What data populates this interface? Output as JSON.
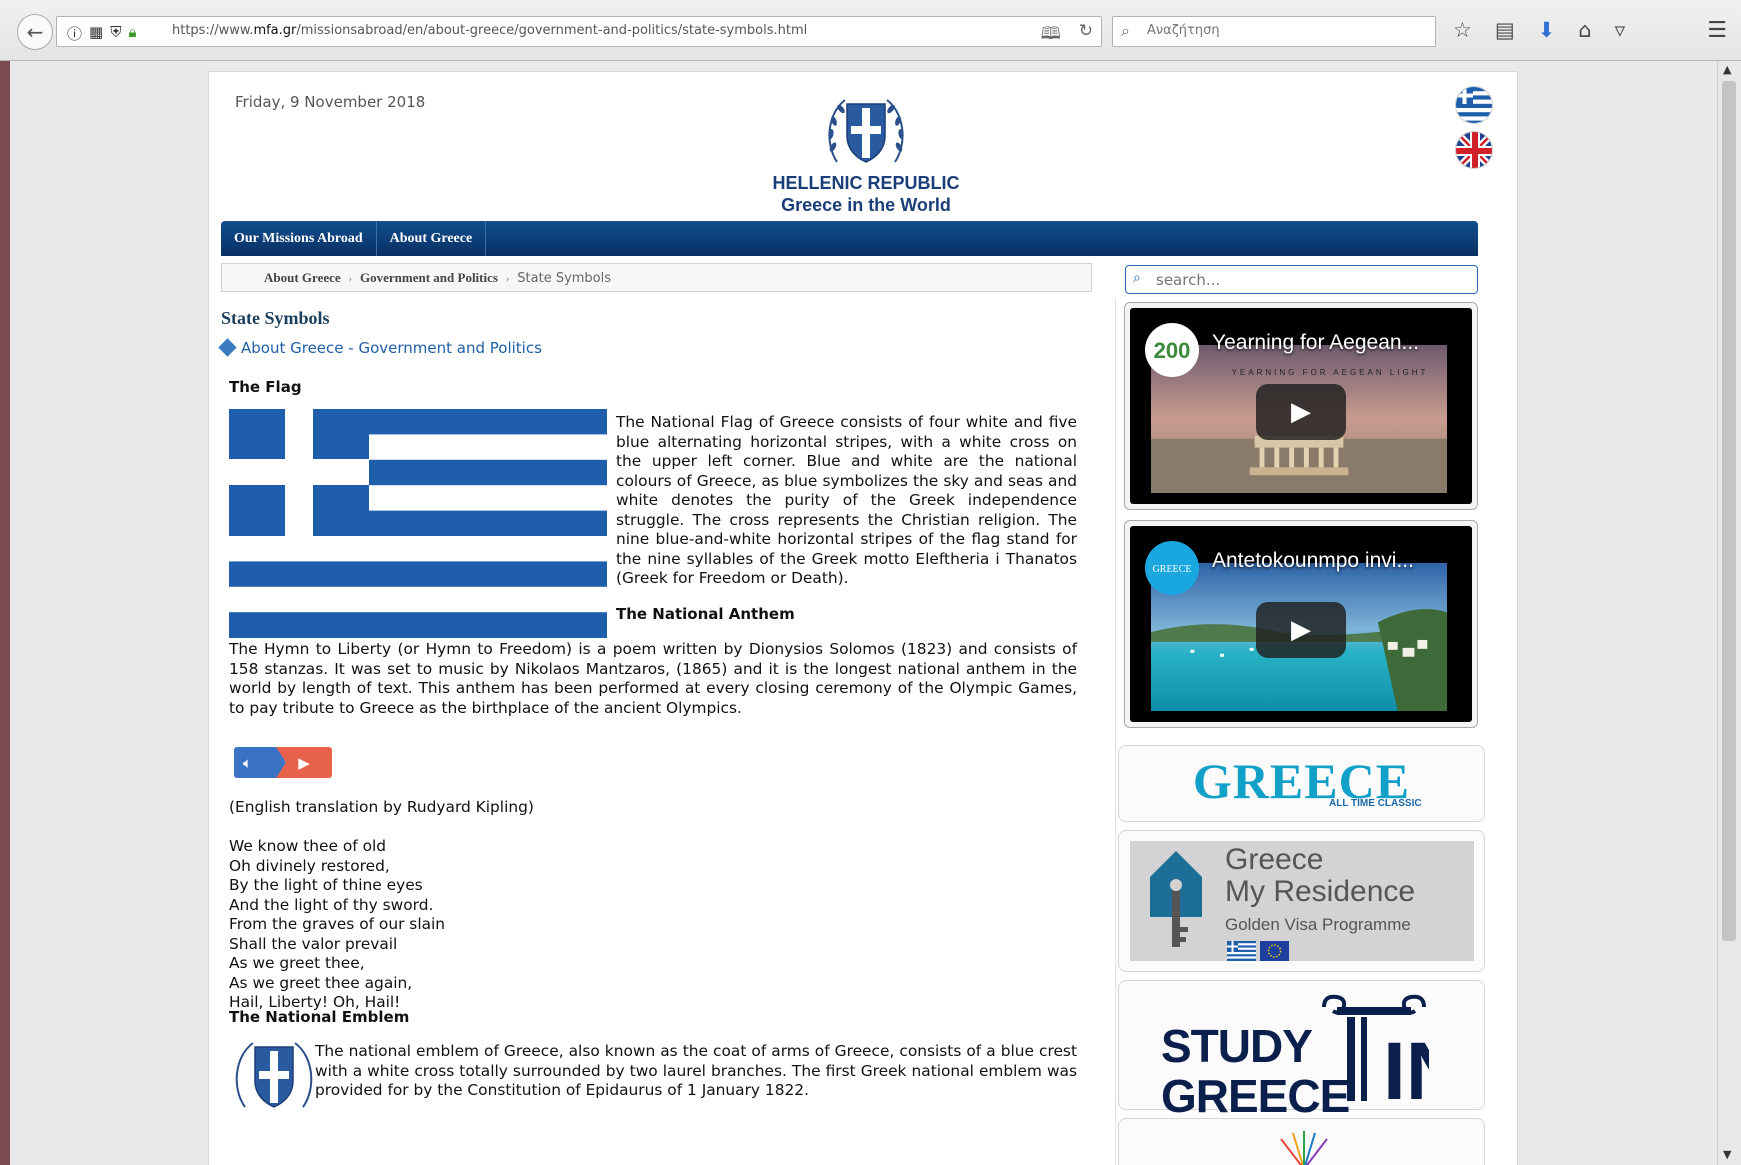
{
  "browser": {
    "url_prefix": "https://www.",
    "url_domain": "mfa.gr",
    "url_path": "/missionsabroad/en/about-greece/government-and-politics/state-symbols.html",
    "search_placeholder": "Αναζήτηση"
  },
  "header": {
    "date": "Friday, 9 November 2018",
    "title_line1": "HELLENIC REPUBLIC",
    "title_line2": "Greece in the World"
  },
  "nav": {
    "items": [
      "Our Missions Abroad",
      "About Greece"
    ]
  },
  "breadcrumb": {
    "items": [
      "About Greece",
      "Government and Politics"
    ],
    "current": "State Symbols"
  },
  "content": {
    "page_title": "State Symbols",
    "parent_link": "About Greece - Government and Politics",
    "flag_heading": "The Flag",
    "flag_text": "The National Flag of Greece consists of four white and five blue alternating horizontal stripes, with a white cross on the upper left corner. Blue and white are the national colours of Greece, as blue symbolizes the sky and seas and white denotes the purity of the Greek independence struggle. The cross represents the Christian religion. The nine blue-and-white horizontal stripes of the flag stand for the nine syllables of the Greek motto Eleftheria i Thanatos (Greek for Freedom or Death).",
    "anthem_heading": "The National Anthem",
    "anthem_text": "The Hymn to Liberty (or Hymn to Freedom) is a poem written by Dionysios Solomos (1823) and consists of 158 stanzas. It was set to music by Nikolaos Mantzaros, (1865) and it is the longest national anthem in the world by length of text. This anthem has been performed at every closing ceremony of the Olympic Games, to pay tribute to Greece as the birthplace of the ancient Olympics.",
    "translation_note": "(English translation by Rudyard Kipling)",
    "poem": [
      "We know thee of old",
      "Oh divinely restored,",
      "By the light of thine eyes",
      "And the light of thy sword.",
      "From the graves of our slain",
      "Shall the valor prevail",
      "As we greet thee,",
      "As we greet thee again,",
      "Hail, Liberty! Oh, Hail!"
    ],
    "emblem_heading": "The National Emblem",
    "emblem_text": "The national emblem of Greece, also known as the coat of arms of Greece, consists of a blue crest with a white cross totally surrounded by two laurel branches. The first Greek national emblem was provided for by the Constitution of Epidaurus of 1 January 1822."
  },
  "sidebar": {
    "search_placeholder": "search...",
    "videos": [
      {
        "title": "Yearning for Aegean...",
        "logo_text": "200",
        "subtitle": "YEARNING FOR AEGEAN LIGHT"
      },
      {
        "title": "Antetokounmpo invi...",
        "logo_text": "GREECE"
      }
    ],
    "banner_greece": {
      "title": "GREECE",
      "subtitle": "ALL TIME CLASSIC"
    },
    "banner_residence": {
      "line1": "Greece",
      "line2": "My Residence",
      "line3": "Golden Visa Programme"
    },
    "banner_study": {
      "line1": "STUDY",
      "line2": "GREECE",
      "letter": "IN"
    }
  },
  "colors": {
    "nav_blue": "#0a2f63",
    "flag_blue": "#1f5ead",
    "link_blue": "#1f5fa6",
    "audio_blue": "#3b73c4",
    "audio_red": "#e8614a"
  }
}
